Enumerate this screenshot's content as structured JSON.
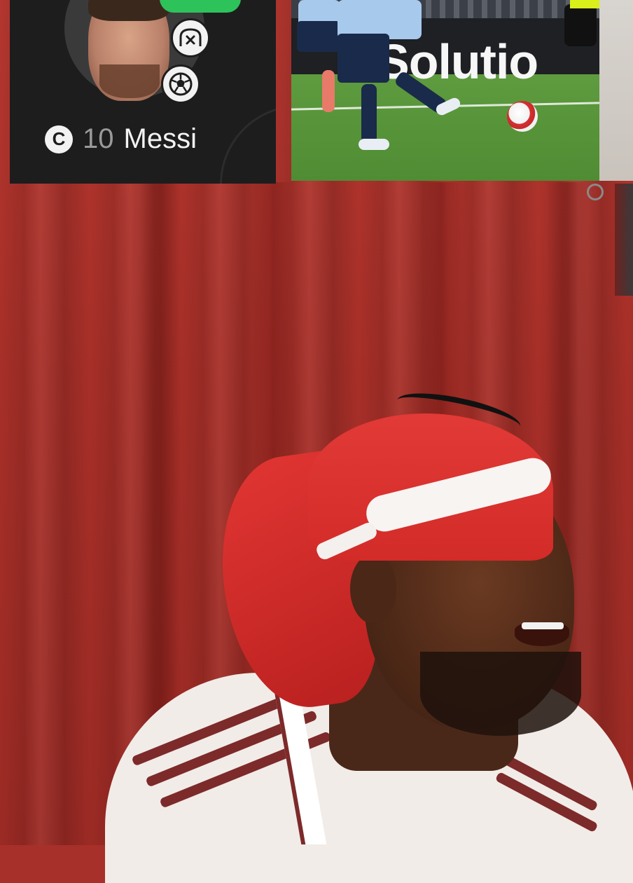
{
  "player_card": {
    "captain_label": "C",
    "number": "10",
    "name": "Messi",
    "icons": [
      "substitution-icon",
      "goal-ball-icon",
      "captain-icon"
    ],
    "rating_badge_color": "#2ec25a"
  },
  "match_photo": {
    "ad_board_text": "Solutio"
  },
  "colors": {
    "curtain": "#a8302a",
    "card_background": "#1d1d1d",
    "durag": "#e23a36"
  }
}
